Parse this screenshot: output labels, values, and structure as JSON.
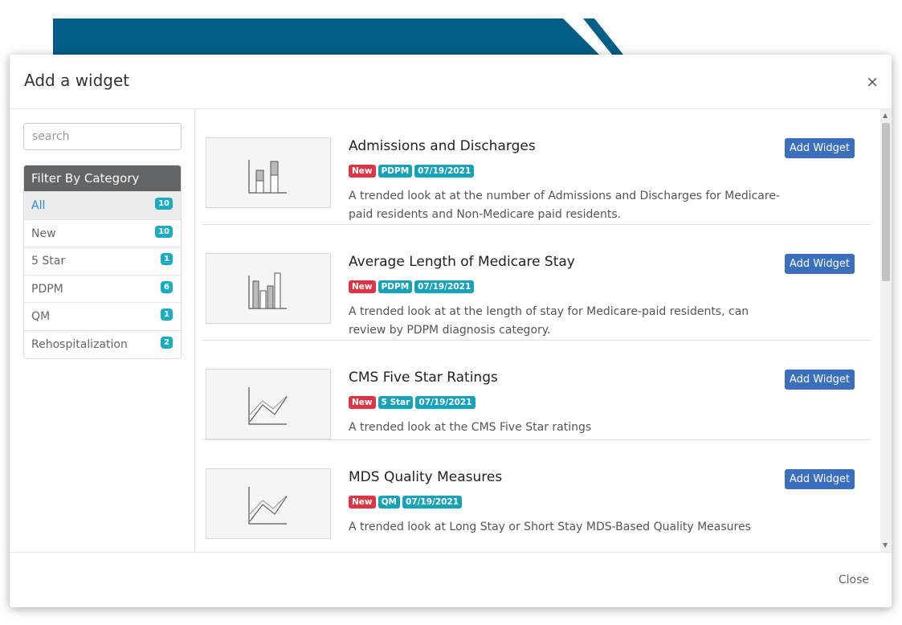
{
  "modal": {
    "title": "Add a widget",
    "close_symbol": "×",
    "footer_close": "Close"
  },
  "sidebar": {
    "search_placeholder": "search",
    "filter_title": "Filter By Category",
    "items": [
      {
        "label": "All",
        "count": "10"
      },
      {
        "label": "New",
        "count": "10"
      },
      {
        "label": "5 Star",
        "count": "1"
      },
      {
        "label": "PDPM",
        "count": "6"
      },
      {
        "label": "QM",
        "count": "1"
      },
      {
        "label": "Rehospitalization",
        "count": "2"
      }
    ]
  },
  "widgets": [
    {
      "title": "Admissions and Discharges",
      "tags": [
        "New",
        "PDPM",
        "07/19/2021"
      ],
      "description": "A trended look at at the number of Admissions and Discharges for Medicare-paid residents and Non-Medicare paid residents.",
      "button": "Add Widget",
      "thumbnail_icon": "stacked-bar-chart-icon"
    },
    {
      "title": "Average Length of Medicare Stay",
      "tags": [
        "New",
        "PDPM",
        "07/19/2021"
      ],
      "description": "A trended look at at the length of stay for Medicare-paid residents, can review by PDPM diagnosis category.",
      "button": "Add Widget",
      "thumbnail_icon": "bar-chart-icon"
    },
    {
      "title": "CMS Five Star Ratings",
      "tags": [
        "New",
        "5 Star",
        "07/19/2021"
      ],
      "description": "A trended look at the CMS Five Star ratings",
      "button": "Add Widget",
      "thumbnail_icon": "line-chart-icon"
    },
    {
      "title": "MDS Quality Measures",
      "tags": [
        "New",
        "QM",
        "07/19/2021"
      ],
      "description": "A trended look at Long Stay or Short Stay MDS-Based Quality Measures",
      "button": "Add Widget",
      "thumbnail_icon": "line-chart-icon"
    }
  ],
  "colors": {
    "banner": "#005e87",
    "badge": "#1cabc0",
    "tag_new": "#dc3545",
    "tag_category": "#17a2b8",
    "button": "#3b6ebd",
    "filter_header": "#636466",
    "active_link": "#2b87d1"
  }
}
